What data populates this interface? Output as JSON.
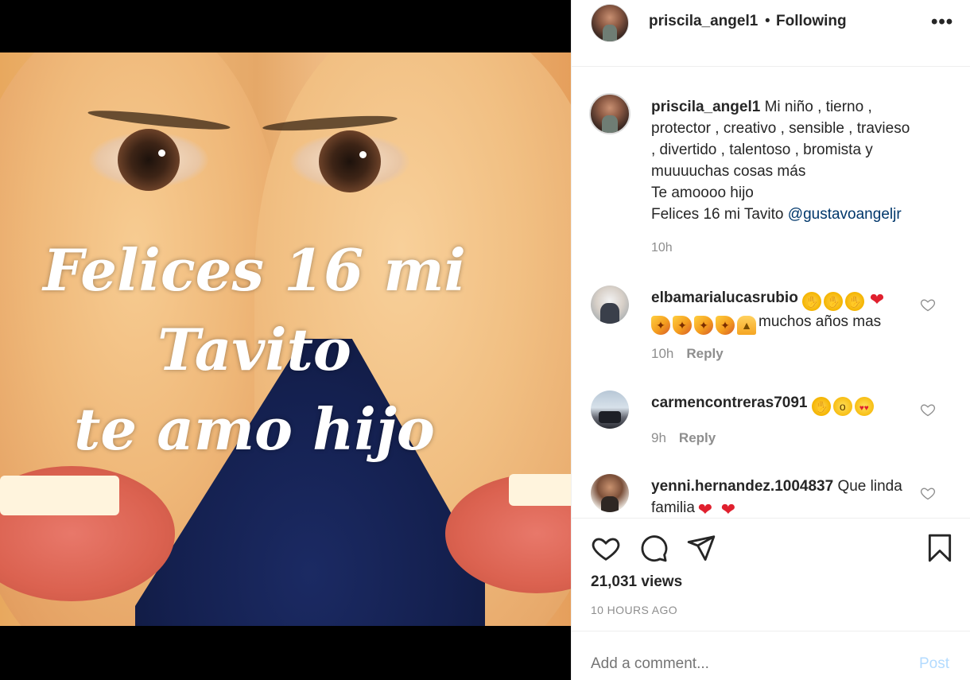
{
  "media": {
    "overlay_lines": [
      "Felices 16 mi",
      "Tavito",
      "te amo hijo"
    ]
  },
  "header": {
    "username": "priscila_angel1",
    "separator": "•",
    "follow_state": "Following",
    "more_icon": "more-horizontal-icon"
  },
  "caption": {
    "username": "priscila_angel1",
    "lines": [
      "Mi niño , tierno ,",
      "protector , creativo , sensible , travieso",
      ", divertido , talentoso , bromista y",
      "muuuuchas cosas más",
      "Te amoooo hijo",
      "Felices 16 mi Tavito"
    ],
    "mention": "@gustavoangeljr",
    "time": "10h"
  },
  "comments": [
    {
      "username": "elbamarialucasrubio",
      "text": "muchos años mas",
      "time": "10h",
      "reply_label": "Reply"
    },
    {
      "username": "carmencontreras7091",
      "text": "",
      "time": "9h",
      "reply_label": "Reply"
    },
    {
      "username": "yenni.hernandez.1004837",
      "text": "Que linda familia",
      "time": "",
      "reply_label": ""
    }
  ],
  "actions": {
    "like_icon": "heart-outline-icon",
    "comment_icon": "comment-bubble-icon",
    "share_icon": "paper-plane-icon",
    "save_icon": "bookmark-icon",
    "views": "21,031 views",
    "posted": "10 HOURS AGO"
  },
  "add_comment": {
    "placeholder": "Add a comment...",
    "post_label": "Post",
    "post_color": "#b3dbff"
  },
  "colors": {
    "mention": "#00376b",
    "muted": "#8e8e8e",
    "text": "#262626"
  }
}
